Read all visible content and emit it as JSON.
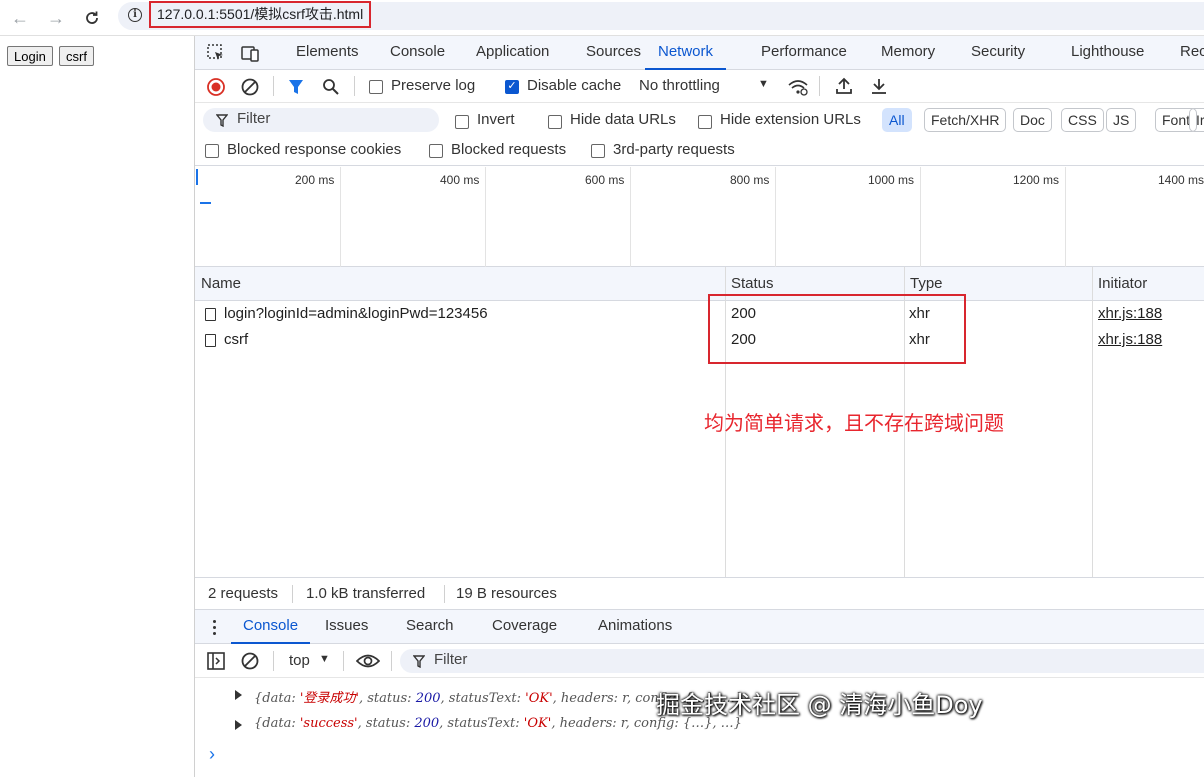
{
  "browser": {
    "url": "127.0.0.1:5501/模拟csrf攻击.html"
  },
  "page": {
    "login_button": "Login",
    "csrf_button": "csrf"
  },
  "devtools": {
    "tabs": [
      "Elements",
      "Console",
      "Application",
      "Sources",
      "Network",
      "Performance",
      "Memory",
      "Security",
      "Lighthouse",
      "Rec"
    ],
    "active_tab": "Network",
    "toolbar": {
      "preserve_log": "Preserve log",
      "disable_cache": "Disable cache",
      "throttling": "No throttling"
    },
    "filter": {
      "placeholder": "Filter",
      "invert": "Invert",
      "hide_data_urls": "Hide data URLs",
      "hide_extension_urls": "Hide extension URLs",
      "types": [
        "All",
        "Fetch/XHR",
        "Doc",
        "CSS",
        "JS",
        "Font",
        "Ir"
      ]
    },
    "filter_row3": {
      "blocked_cookies": "Blocked response cookies",
      "blocked_requests": "Blocked requests",
      "third_party": "3rd-party requests"
    },
    "timeline": {
      "labels": [
        "200 ms",
        "400 ms",
        "600 ms",
        "800 ms",
        "1000 ms",
        "1200 ms",
        "1400 ms"
      ]
    },
    "table": {
      "columns": [
        "Name",
        "Status",
        "Type",
        "Initiator"
      ],
      "rows": [
        {
          "name": "login?loginId=admin&loginPwd=123456",
          "status": "200",
          "type": "xhr",
          "initiator": "xhr.js:188"
        },
        {
          "name": "csrf",
          "status": "200",
          "type": "xhr",
          "initiator": "xhr.js:188"
        }
      ]
    },
    "annotation": "均为简单请求，且不存在跨域问题",
    "status_bar": {
      "requests": "2 requests",
      "transferred": "1.0 kB transferred",
      "resources": "19 B resources"
    },
    "drawer": {
      "tabs": [
        "Console",
        "Issues",
        "Search",
        "Coverage",
        "Animations"
      ],
      "active_tab": "Console",
      "context": "top",
      "filter_placeholder": "Filter"
    },
    "console": {
      "line1": {
        "open": "{data: ",
        "data": "'登录成功'",
        "status_key": ", status: ",
        "status": "200",
        "statusText_key": ", statusText: ",
        "statusText": "'OK'",
        "rest": ", headers: r, config: {…},  …}"
      },
      "line2": {
        "open": "{data: ",
        "data": "'success'",
        "status_key": ", status: ",
        "status": "200",
        "statusText_key": ", statusText: ",
        "statusText": "'OK'",
        "rest": ", headers: r, config: {…},  …}"
      },
      "prompt": "›"
    }
  },
  "watermark": "掘金技术社区 @ 清海小鱼Doy",
  "colors": {
    "accent": "#0b57d0",
    "annotation_red": "#e8262e",
    "record_red": "#d93025"
  }
}
